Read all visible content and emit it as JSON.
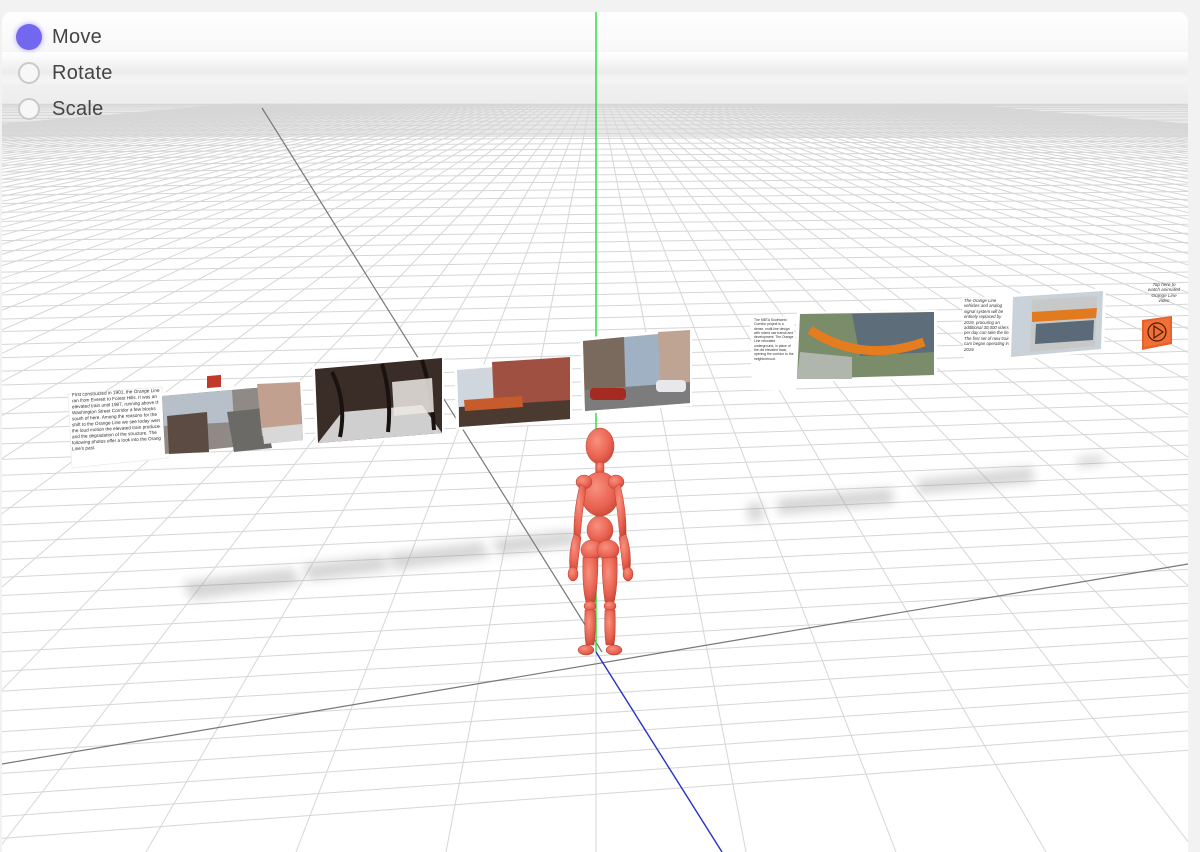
{
  "modes": {
    "selected": "move",
    "items": [
      {
        "key": "move",
        "label": "Move"
      },
      {
        "key": "rotate",
        "label": "Rotate"
      },
      {
        "key": "scale",
        "label": "Scale"
      }
    ]
  },
  "panels": {
    "intro_text": "First constructed in 1901, the Orange Line ran from Everett to Forest Hills. It was an elevated train until 1987, running above the Washington Street Corridor a few blocks south of here. Among the reasons for the shift to the Orange Line we see today were the loud motion the elevated train produced and the degradation of the structure. The following photos offer a look into the Orange Line's past.",
    "middle_text": "The MBTA Southwest Corridor project is a dense, multi-line design with mixed use transit and development. The Orange Line relocated underground, in place of the old elevated track, opening the corridor to the neighborhood.",
    "new_cars_text": "The Orange Line vehicles and analog signal system will be entirely replaced by 2019, procuring an additional 30,000 riders per day can take the line. The first set of new train cars began operating in 2019.",
    "tap_text": "Tap here to watch animated Orange Line video"
  },
  "colors": {
    "accent": "#7367f0",
    "figure": "#ef6f5e",
    "play_button": "#e8612c",
    "axis_y": "#22dd33",
    "axis_z": "#2233cc",
    "grid": "#d8d8d8"
  },
  "icons": {
    "play": "play-icon"
  }
}
